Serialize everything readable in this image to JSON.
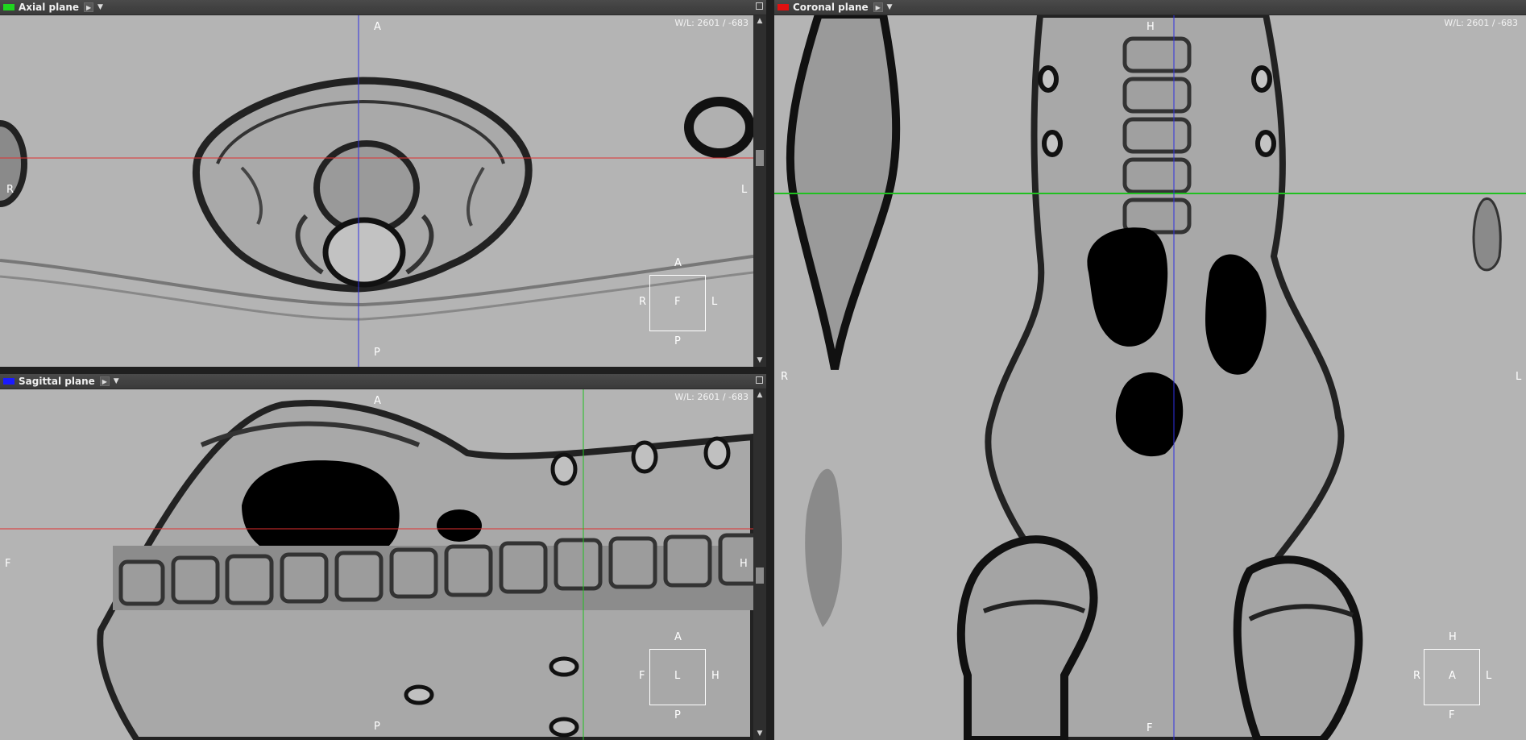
{
  "axial": {
    "title": "Axial plane",
    "color": "#1fd61f",
    "wl": "W/L: 2601 / -683",
    "labels": {
      "top": "A",
      "bottom": "P",
      "left": "R",
      "right": "L"
    },
    "cube": {
      "top": "A",
      "left": "R",
      "center": "F",
      "right": "L",
      "bottom": "P"
    }
  },
  "sagittal": {
    "title": "Sagittal plane",
    "color": "#1a1aff",
    "wl": "W/L: 2601 / -683",
    "labels": {
      "top": "A",
      "bottom": "P",
      "left": "F",
      "right": "H"
    },
    "cube": {
      "top": "A",
      "left": "F",
      "center": "L",
      "right": "H",
      "bottom": "P"
    }
  },
  "coronal": {
    "title": "Coronal plane",
    "color": "#e01010",
    "wl": "W/L: 2601 / -683",
    "labels": {
      "top": "H",
      "bottom": "F",
      "left": "R",
      "right": "L"
    },
    "cube": {
      "top": "H",
      "left": "R",
      "center": "A",
      "right": "L",
      "bottom": "F"
    }
  },
  "header_icons": {
    "play": "play-icon",
    "dropdown": "dropdown-arrow-icon",
    "maximize": "maximize-icon"
  }
}
